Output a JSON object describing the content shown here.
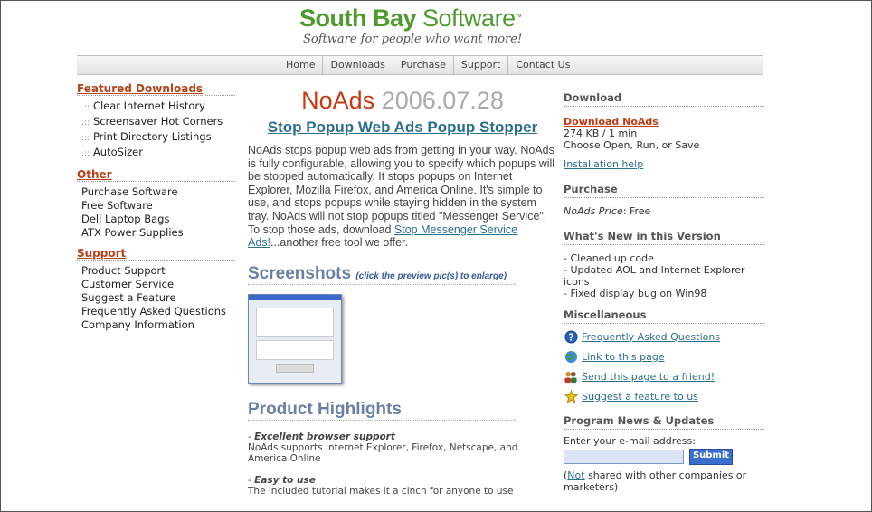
{
  "header": {
    "brand_bold": "South Bay",
    "brand_light": "Software",
    "trademark": "™",
    "tagline": "Software for people who want more!"
  },
  "nav": [
    "Home",
    "Downloads",
    "Purchase",
    "Support",
    "Contact Us"
  ],
  "left": {
    "featured_heading": "Featured Downloads",
    "featured_bullet": ".::",
    "featured": [
      "Clear Internet History",
      "Screensaver Hot Corners",
      "Print Directory Listings",
      "AutoSizer"
    ],
    "other_heading": "Other",
    "other": [
      "Purchase Software",
      "Free Software",
      "Dell Laptop Bags",
      "ATX Power Supplies"
    ],
    "support_heading": "Support",
    "support": [
      "Product Support",
      "Customer Service",
      "Suggest a Feature",
      "Frequently Asked Questions",
      "Company Information"
    ]
  },
  "main": {
    "product_name": "NoAds",
    "product_date": "2006.07.28",
    "subtitle": "Stop Popup Web Ads Popup Stopper",
    "description": "NoAds stops popup web ads from getting in your way. NoAds is fully configurable, allowing you to specify which popups will be stopped automatically. It stops popups on Internet Explorer, Mozilla Firefox, and America Online. It's simple to use, and stops popups while staying hidden in the system tray. NoAds will not stop popups titled \"Messenger Service\". To stop those ads, download ",
    "description_link": "Stop Messenger Service Ads!",
    "description_tail": "...another free tool we offer.",
    "screenshots_heading": "Screenshots",
    "screenshots_note": "(click the preview pic(s) to enlarge)",
    "highlights_heading": "Product Highlights",
    "highlights": [
      {
        "title": "Excellent browser support",
        "text": "NoAds supports Internet Explorer, Firefox, Netscape, and America Online"
      },
      {
        "title": "Easy to use",
        "text": "The included tutorial makes it a cinch for anyone to use"
      }
    ],
    "dash": "- "
  },
  "right": {
    "download_heading": "Download",
    "download_link": "Download NoAds",
    "download_size": "274 KB / 1 min",
    "download_hint": "Choose Open, Run, or Save",
    "install_help": "Installation help",
    "purchase_heading": "Purchase",
    "price_label": "NoAds Price",
    "price_sep": ":",
    "price_value": "Free",
    "whatsnew_heading": "What's New in this Version",
    "whatsnew": [
      "- Cleaned up code",
      "- Updated AOL and Internet Explorer icons",
      "- Fixed display bug on Win98"
    ],
    "misc_heading": "Miscellaneous",
    "misc": [
      {
        "label": "Frequently Asked Questions",
        "icon": "help-icon"
      },
      {
        "label": "Link to this page",
        "icon": "globe-icon"
      },
      {
        "label": "Send this page to a friend!",
        "icon": "people-icon"
      },
      {
        "label": "Suggest a feature to us",
        "icon": "star-icon"
      }
    ],
    "news_heading": "Program News & Updates",
    "email_label": "Enter your e-mail address:",
    "submit_label": "Submit",
    "privacy_open": "(",
    "privacy_link": "Not",
    "privacy_rest": " shared with other companies or marketers)"
  },
  "colors": {
    "brand_green": "#4d9a2f",
    "accent_red": "#c53a12",
    "link_blue": "#2a6f8e",
    "heading_slate": "#6a7fa3"
  }
}
